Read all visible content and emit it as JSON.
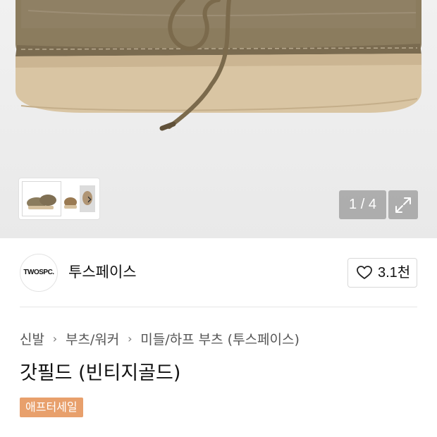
{
  "gallery": {
    "counter": "1 / 4",
    "next_icon": "chevron-right-icon",
    "fullscreen_icon": "expand-icon",
    "image_description_icon": "product-boot-image",
    "colors": {
      "suede": "#8a7b5d",
      "sole": "#d9c4a2",
      "background": "#eeeeee"
    }
  },
  "brand": {
    "logo_text": "TWOSPC.",
    "name": "투스페이스",
    "like_icon": "heart-icon",
    "like_count": "3.1천"
  },
  "breadcrumb": {
    "items": [
      "신발",
      "부츠/워커",
      "미들/하프 부츠 (투스페이스)"
    ],
    "separator": "›"
  },
  "product": {
    "title": "갓필드 (빈티지골드)",
    "badge": "애프터세일",
    "badge_color": "#e8a06c"
  }
}
